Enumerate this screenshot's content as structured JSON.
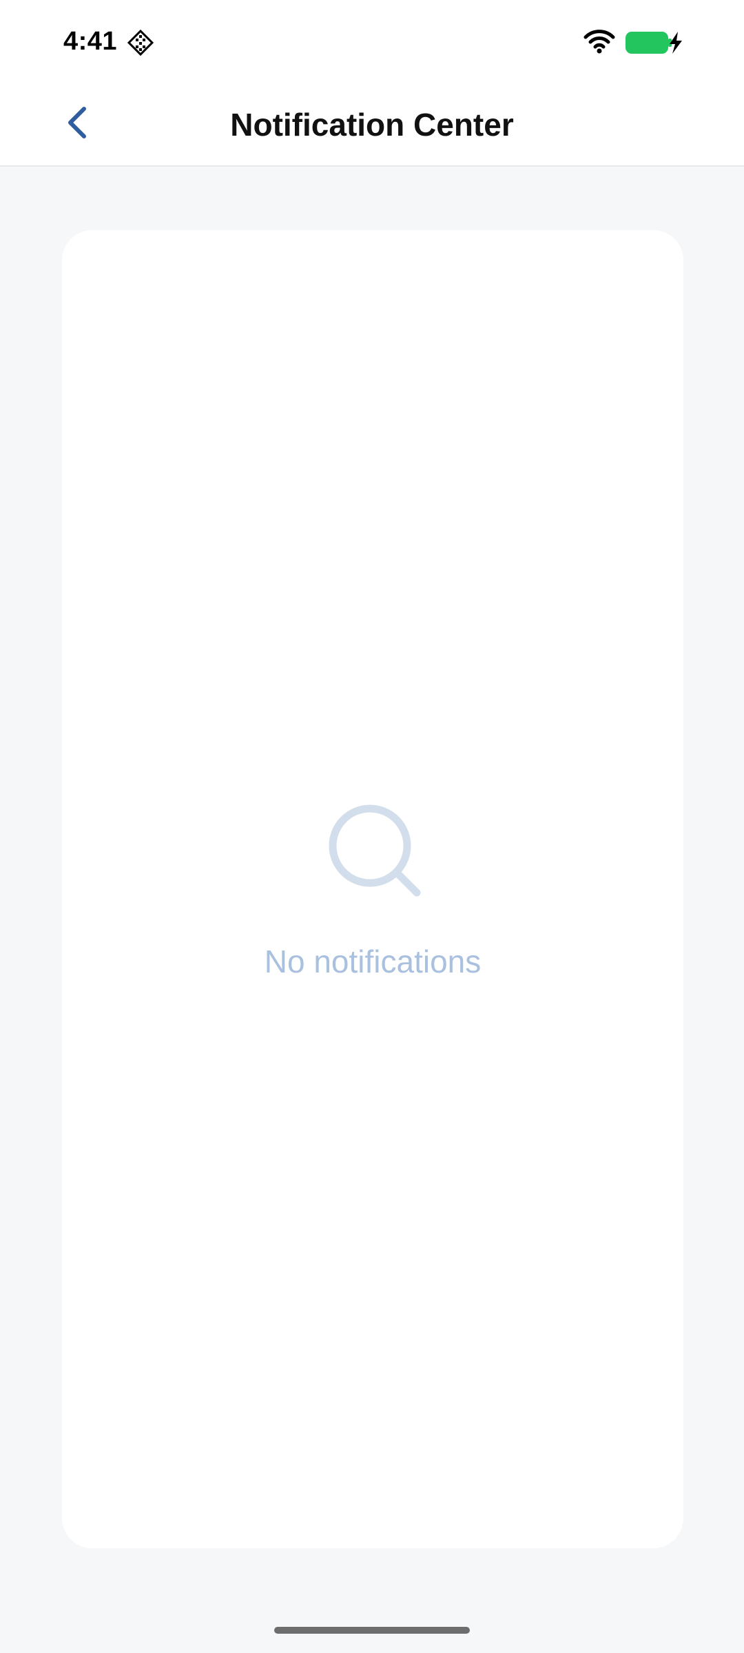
{
  "status_bar": {
    "time": "4:41",
    "app_icon": "diamond-grid-icon",
    "wifi_icon": "wifi-icon",
    "battery_icon": "battery-charging-icon",
    "battery_color": "#22c55e"
  },
  "header": {
    "title": "Notification Center",
    "back_icon": "chevron-left-icon",
    "back_color": "#2f5d9f"
  },
  "main": {
    "empty_icon": "search-icon",
    "empty_message": "No notifications",
    "empty_color": "#a9c0df"
  }
}
